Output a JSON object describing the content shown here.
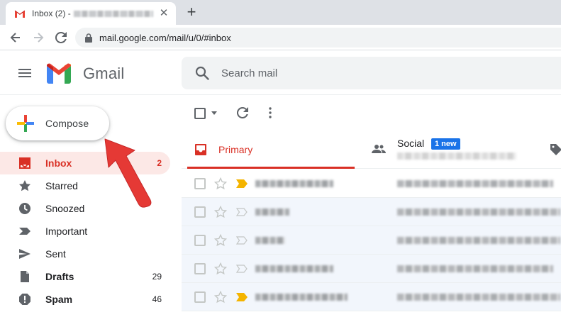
{
  "browser": {
    "tab_title": "Inbox (2) -",
    "tab_close": "✕",
    "new_tab": "+",
    "url": "mail.google.com/mail/u/0/#inbox"
  },
  "gmail": {
    "brand": "Gmail",
    "search_placeholder": "Search mail"
  },
  "sidebar": {
    "compose_label": "Compose",
    "items": [
      {
        "label": "Inbox",
        "count": "2",
        "icon": "inbox-icon",
        "active": true,
        "bold": true
      },
      {
        "label": "Starred",
        "count": "",
        "icon": "star-icon"
      },
      {
        "label": "Snoozed",
        "count": "",
        "icon": "clock-icon"
      },
      {
        "label": "Important",
        "count": "",
        "icon": "important-icon"
      },
      {
        "label": "Sent",
        "count": "",
        "icon": "send-icon"
      },
      {
        "label": "Drafts",
        "count": "29",
        "icon": "draft-icon",
        "bold": true
      },
      {
        "label": "Spam",
        "count": "46",
        "icon": "spam-icon",
        "bold": true
      }
    ]
  },
  "categories": {
    "primary": "Primary",
    "social": "Social",
    "social_badge": "1 new"
  },
  "emails": [
    {
      "read": false,
      "important": true
    },
    {
      "read": true,
      "important": false
    },
    {
      "read": true,
      "important": false
    },
    {
      "read": true,
      "important": false
    },
    {
      "read": true,
      "important": true
    }
  ],
  "colors": {
    "accent_red": "#d93025",
    "active_bg": "#fce8e6",
    "badge_blue": "#1a73e8",
    "important_yellow": "#f4b400",
    "arrow_red": "#e53935"
  }
}
